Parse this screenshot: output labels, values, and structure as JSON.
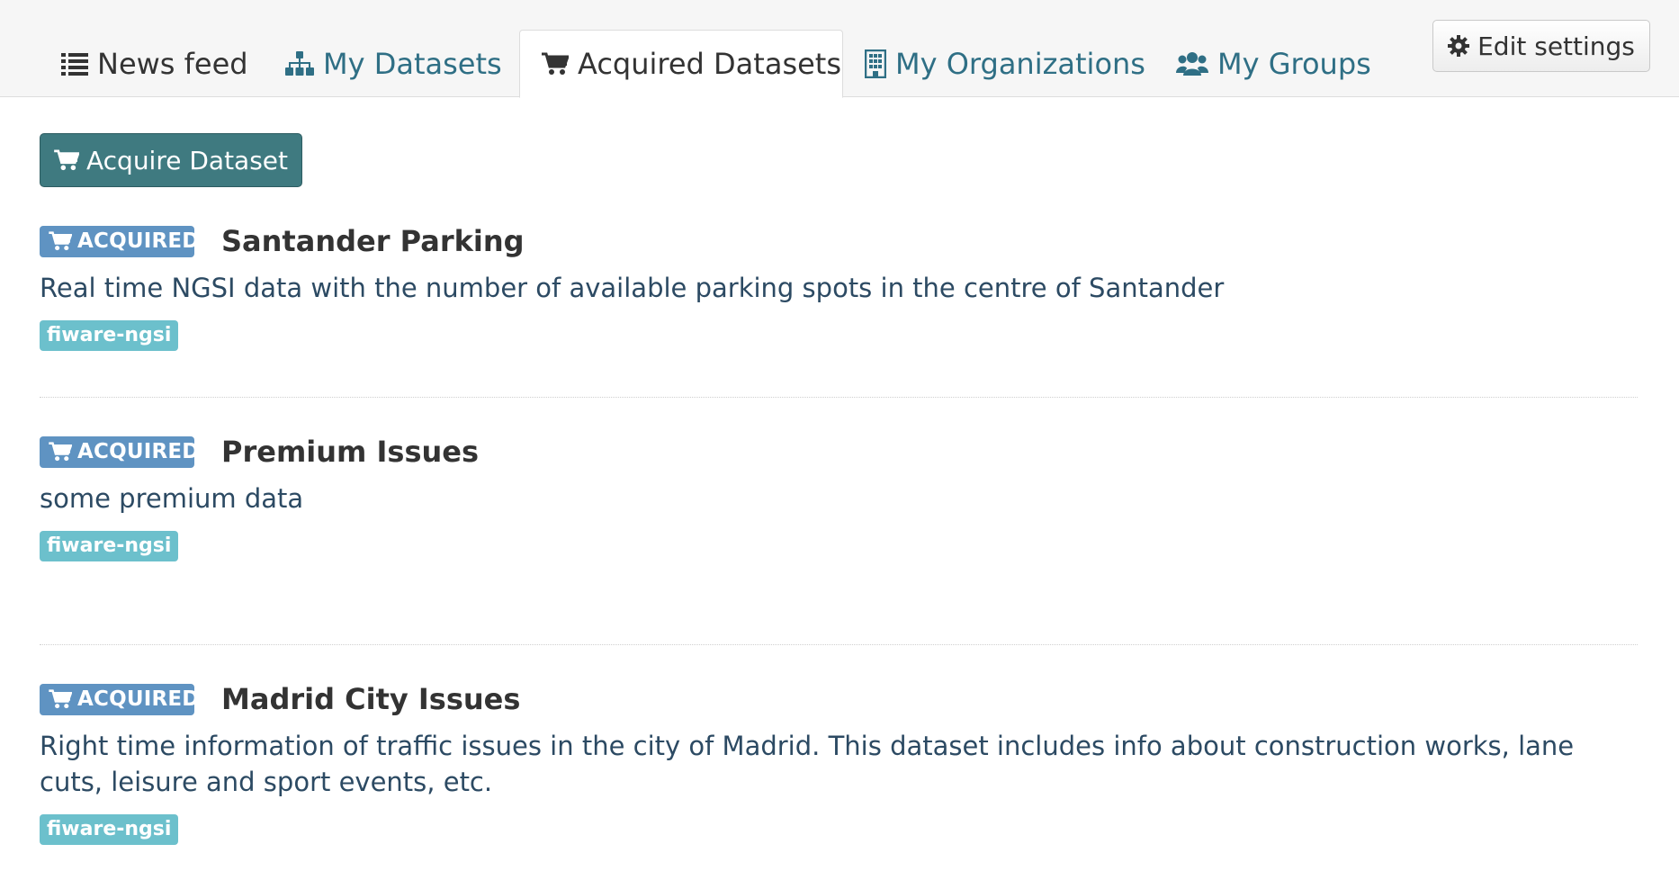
{
  "tabs": [
    {
      "label": "News feed",
      "icon": "list-icon",
      "active": false
    },
    {
      "label": "My Datasets",
      "icon": "sitemap-icon",
      "active": false
    },
    {
      "label": "Acquired Datasets",
      "icon": "cart-icon",
      "active": true
    },
    {
      "label": "My Organizations",
      "icon": "building-icon",
      "active": false
    },
    {
      "label": "My Groups",
      "icon": "users-icon",
      "active": false
    }
  ],
  "toolbar": {
    "edit_settings_label": "Edit settings",
    "acquire_label": "Acquire Dataset"
  },
  "datasets": [
    {
      "badge": "ACQUIRED",
      "title": "Santander Parking",
      "description": "Real time NGSI data with the number of available parking spots in the centre of Santander",
      "tag": "fiware-ngsi"
    },
    {
      "badge": "ACQUIRED",
      "title": "Premium Issues",
      "description": "some premium data",
      "tag": "fiware-ngsi"
    },
    {
      "badge": "ACQUIRED",
      "title": "Madrid City Issues",
      "description": "Right time information of traffic issues in the city of Madrid. This dataset includes info about construction works, lane cuts, leisure and sport events, etc.",
      "tag": "fiware-ngsi"
    }
  ],
  "colors": {
    "link": "#2f6f85",
    "primary_button": "#3f7a80",
    "badge": "#5f93c2",
    "tag": "#6cc0cc"
  }
}
